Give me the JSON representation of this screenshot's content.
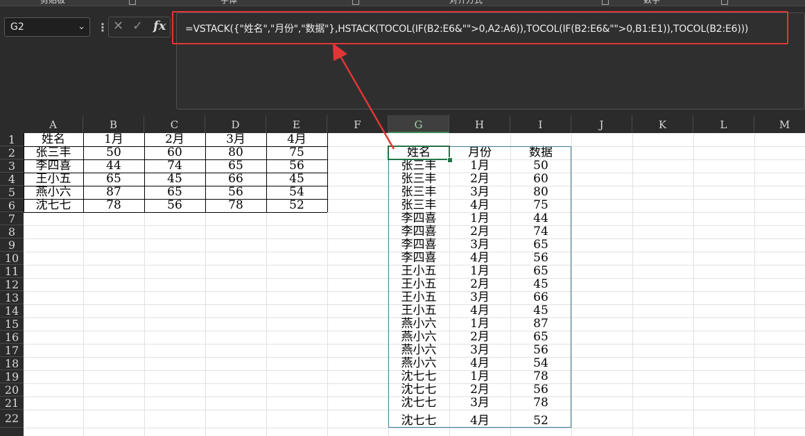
{
  "ribbon": {
    "groups": [
      "剪贴板",
      "字体",
      "对齐方式",
      "数字"
    ]
  },
  "formula_bar": {
    "name_box": "G2",
    "fx": "fx",
    "formula": "=VSTACK({\"姓名\",\"月份\",\"数据\"},HSTACK(TOCOL(IF(B2:E6&\"\">0,A2:A6)),TOCOL(IF(B2:E6&\"\">0,B1:E1)),TOCOL(B2:E6)))"
  },
  "columns": [
    "A",
    "B",
    "C",
    "D",
    "E",
    "F",
    "G",
    "H",
    "I",
    "J",
    "K",
    "L",
    "M"
  ],
  "rows": [
    "1",
    "2",
    "3",
    "4",
    "5",
    "6",
    "7",
    "8",
    "9",
    "10",
    "11",
    "12",
    "13",
    "14",
    "15",
    "16",
    "17",
    "18",
    "19",
    "20",
    "21",
    "22"
  ],
  "source_table": {
    "header": [
      "姓名",
      "1月",
      "2月",
      "3月",
      "4月"
    ],
    "rows": [
      [
        "张三丰",
        "50",
        "60",
        "80",
        "75"
      ],
      [
        "李四喜",
        "44",
        "74",
        "65",
        "56"
      ],
      [
        "王小五",
        "65",
        "45",
        "66",
        "45"
      ],
      [
        "燕小六",
        "87",
        "65",
        "56",
        "54"
      ],
      [
        "沈七七",
        "78",
        "56",
        "78",
        "52"
      ]
    ]
  },
  "result_table": {
    "header": [
      "姓名",
      "月份",
      "数据"
    ],
    "rows": [
      [
        "张三丰",
        "1月",
        "50"
      ],
      [
        "张三丰",
        "2月",
        "60"
      ],
      [
        "张三丰",
        "3月",
        "80"
      ],
      [
        "张三丰",
        "4月",
        "75"
      ],
      [
        "李四喜",
        "1月",
        "44"
      ],
      [
        "李四喜",
        "2月",
        "74"
      ],
      [
        "李四喜",
        "3月",
        "65"
      ],
      [
        "李四喜",
        "4月",
        "56"
      ],
      [
        "王小五",
        "1月",
        "65"
      ],
      [
        "王小五",
        "2月",
        "45"
      ],
      [
        "王小五",
        "3月",
        "66"
      ],
      [
        "王小五",
        "4月",
        "45"
      ],
      [
        "燕小六",
        "1月",
        "87"
      ],
      [
        "燕小六",
        "2月",
        "65"
      ],
      [
        "燕小六",
        "3月",
        "56"
      ],
      [
        "燕小六",
        "4月",
        "54"
      ],
      [
        "沈七七",
        "1月",
        "78"
      ],
      [
        "沈七七",
        "2月",
        "56"
      ],
      [
        "沈七七",
        "3月",
        "78"
      ],
      [
        "沈七七",
        "4月",
        "52"
      ]
    ]
  },
  "colors": {
    "annotation": "#e23636",
    "selection": "#217346",
    "result_border": "#3d7a9a"
  }
}
